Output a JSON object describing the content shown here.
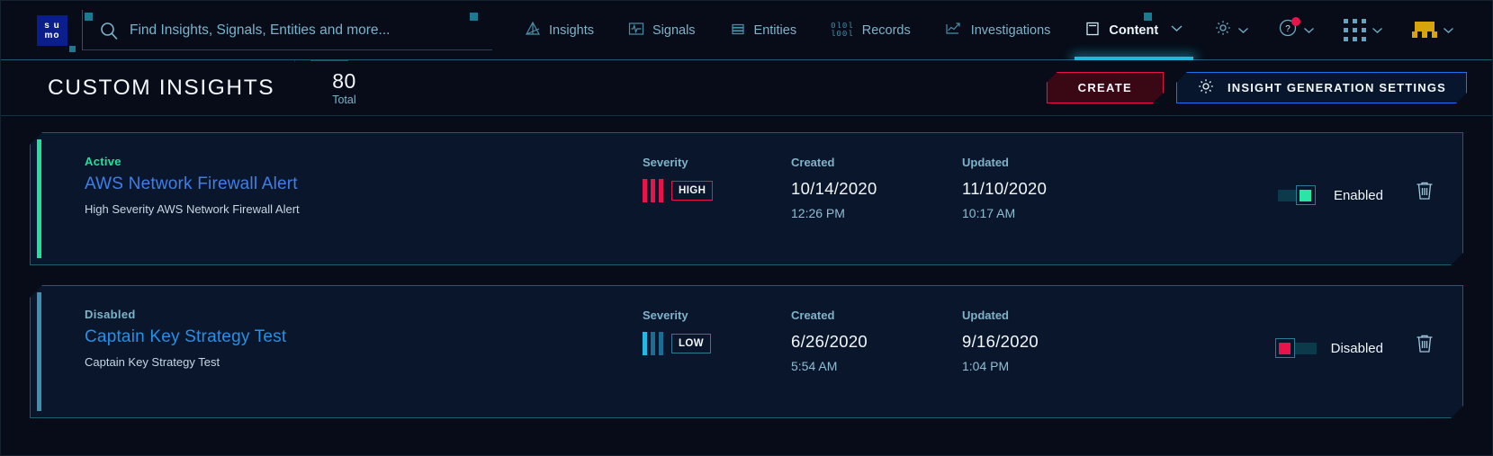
{
  "app": {
    "logo_line1": "s u",
    "logo_line2": "mo"
  },
  "search": {
    "placeholder": "Find Insights, Signals, Entities and more...",
    "value": "",
    "icon": "search-icon"
  },
  "nav": {
    "items": [
      {
        "label": "Insights",
        "icon": "insights-icon",
        "active": false
      },
      {
        "label": "Signals",
        "icon": "signals-icon",
        "active": false
      },
      {
        "label": "Entities",
        "icon": "entities-icon",
        "active": false
      },
      {
        "label": "Records",
        "icon": "records-icon",
        "active": false
      },
      {
        "label": "Investigations",
        "icon": "investigations-icon",
        "active": false
      },
      {
        "label": "Content",
        "icon": "content-icon",
        "active": true
      }
    ],
    "right_icons": [
      {
        "name": "gear-icon",
        "has_badge": false
      },
      {
        "name": "help-icon",
        "has_badge": true
      },
      {
        "name": "apps-grid-icon",
        "has_badge": false
      },
      {
        "name": "user-avatar-icon",
        "has_badge": false
      }
    ]
  },
  "header": {
    "title": "CUSTOM INSIGHTS",
    "count": "80",
    "count_label": "Total",
    "create_label": "CREATE",
    "settings_label": "INSIGHT GENERATION SETTINGS",
    "settings_icon": "gear-icon"
  },
  "columns": {
    "severity": "Severity",
    "created": "Created",
    "updated": "Updated"
  },
  "cards": [
    {
      "status": "Active",
      "status_color": "#1fe39c",
      "accent_color": "#1fe39c",
      "title": "AWS Network Firewall Alert",
      "description": "High Severity AWS Network Firewall Alert",
      "severity": "HIGH",
      "severity_color": "#e8134a",
      "severity_bars": 3,
      "created_date": "10/14/2020",
      "created_time": "12:26 PM",
      "updated_date": "11/10/2020",
      "updated_time": "10:17 AM",
      "toggle_state": "Enabled",
      "toggle_color": "#2ae6a6",
      "toggle_on": true,
      "delete_icon": "trash-icon"
    },
    {
      "status": "Disabled",
      "status_color": "#7fb3c9",
      "accent_color": "#3e8fb0",
      "title": "Captain Key Strategy Test",
      "description": "Captain Key Strategy Test",
      "severity": "LOW",
      "severity_color": "#22a8dd",
      "severity_bars": 3,
      "created_date": "6/26/2020",
      "created_time": "5:54 AM",
      "updated_date": "9/16/2020",
      "updated_time": "1:04 PM",
      "toggle_state": "Disabled",
      "toggle_color": "#e8134a",
      "toggle_on": false,
      "delete_icon": "trash-icon"
    }
  ],
  "colors": {
    "bg": "#070c18",
    "card_bg": "#0a162b",
    "accent_cyan": "#22b8d8",
    "accent_red": "#e8134a",
    "accent_blue": "#1a74f0",
    "text_primary": "#f2f7fb",
    "text_muted": "#7fb3c9"
  }
}
